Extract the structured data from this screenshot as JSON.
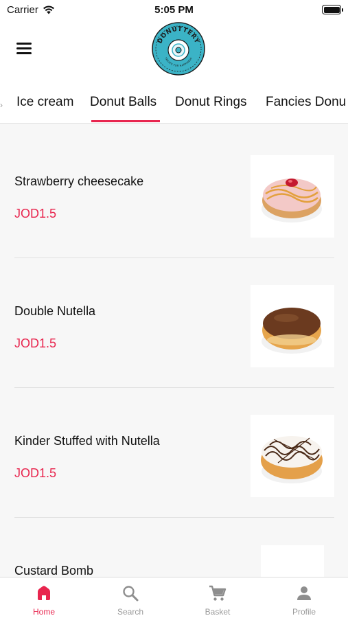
{
  "status_bar": {
    "carrier": "Carrier",
    "time": "5:05 PM"
  },
  "header": {
    "logo_text": "DONUTTERY",
    "logo_tagline": "TREATS FOR HAPPINESS"
  },
  "tabs": [
    {
      "label": "Ice cream"
    },
    {
      "label": "Donut Balls",
      "active": true
    },
    {
      "label": "Donut Rings"
    },
    {
      "label": "Fancies Donu"
    }
  ],
  "products": [
    {
      "name": "Strawberry cheesecake",
      "price": "JOD1.5",
      "image": "strawberry-cheesecake-donut"
    },
    {
      "name": "Double Nutella",
      "price": "JOD1.5",
      "image": "double-nutella-donut"
    },
    {
      "name": "Kinder Stuffed with Nutella",
      "price": "JOD1.5",
      "image": "kinder-nutella-donut"
    },
    {
      "name": "Custard Bomb",
      "price": "",
      "image": "custard-bomb-donut"
    }
  ],
  "tabbar": [
    {
      "label": "Home",
      "icon": "home-icon",
      "active": true
    },
    {
      "label": "Search",
      "icon": "search-icon"
    },
    {
      "label": "Basket",
      "icon": "cart-icon"
    },
    {
      "label": "Profile",
      "icon": "person-icon"
    }
  ],
  "colors": {
    "accent": "#e8254e",
    "logo_teal": "#3bb3c6",
    "text": "#111111",
    "inactive": "#9a9a9a"
  }
}
